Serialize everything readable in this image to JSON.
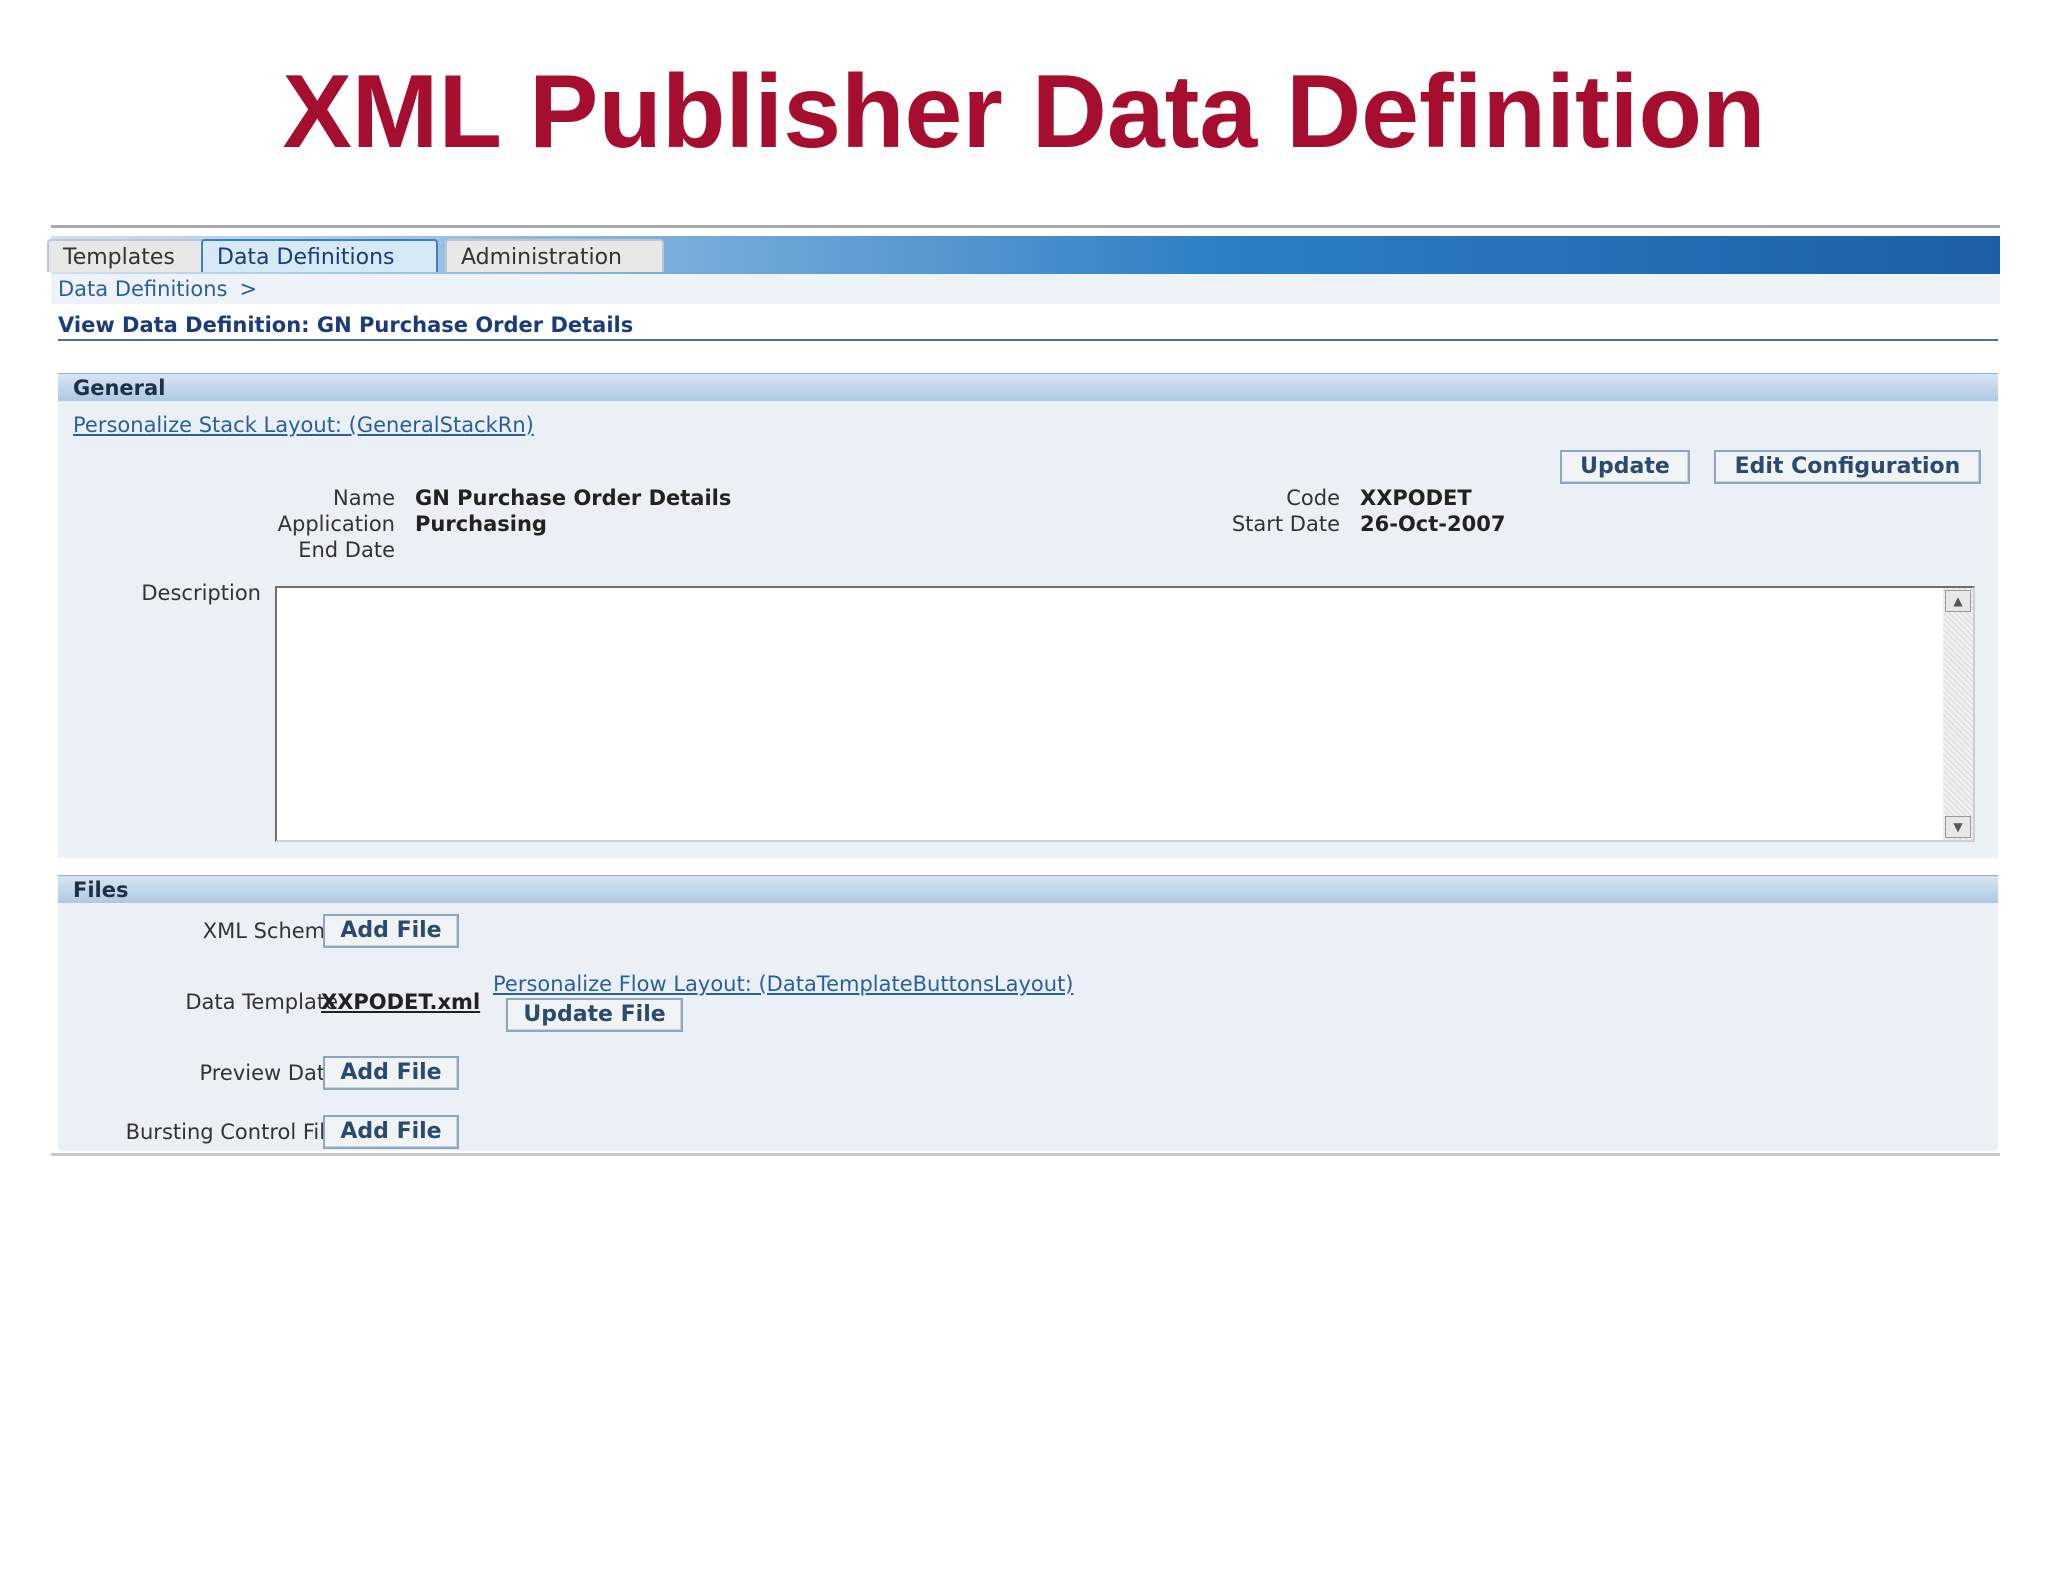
{
  "slide": {
    "title": "XML Publisher Data Definition"
  },
  "tabs": [
    {
      "label": "Templates"
    },
    {
      "label": "Data Definitions"
    },
    {
      "label": "Administration"
    }
  ],
  "breadcrumb": {
    "label": "Data Definitions",
    "separator": ">"
  },
  "page": {
    "heading": "View Data Definition: GN Purchase Order Details"
  },
  "general": {
    "title": "General",
    "personalize_link": "Personalize Stack Layout: (GeneralStackRn)",
    "update_label": "Update",
    "edit_config_label": "Edit Configuration",
    "fields": {
      "name_label": "Name",
      "name_value": "GN Purchase Order Details",
      "application_label": "Application",
      "application_value": "Purchasing",
      "end_date_label": "End Date",
      "code_label": "Code",
      "code_value": "XXPODET",
      "start_date_label": "Start Date",
      "start_date_value": "26-Oct-2007",
      "description_label": "Description"
    }
  },
  "files": {
    "title": "Files",
    "xml_schema_label": "XML Schema",
    "data_template_label": "Data Template",
    "data_template_file": "XXPODET.xml",
    "personalize_flow_link": "Personalize Flow Layout: (DataTemplateButtonsLayout)",
    "update_file_label": "Update File",
    "preview_data_label": "Preview Data",
    "bursting_label": "Bursting Control File",
    "add_file_label": "Add File"
  },
  "colors": {
    "title": "#a50e2f",
    "link": "#2a5f9c",
    "panel": "#eaf0f6",
    "tabbar": "#1c5fa6"
  }
}
